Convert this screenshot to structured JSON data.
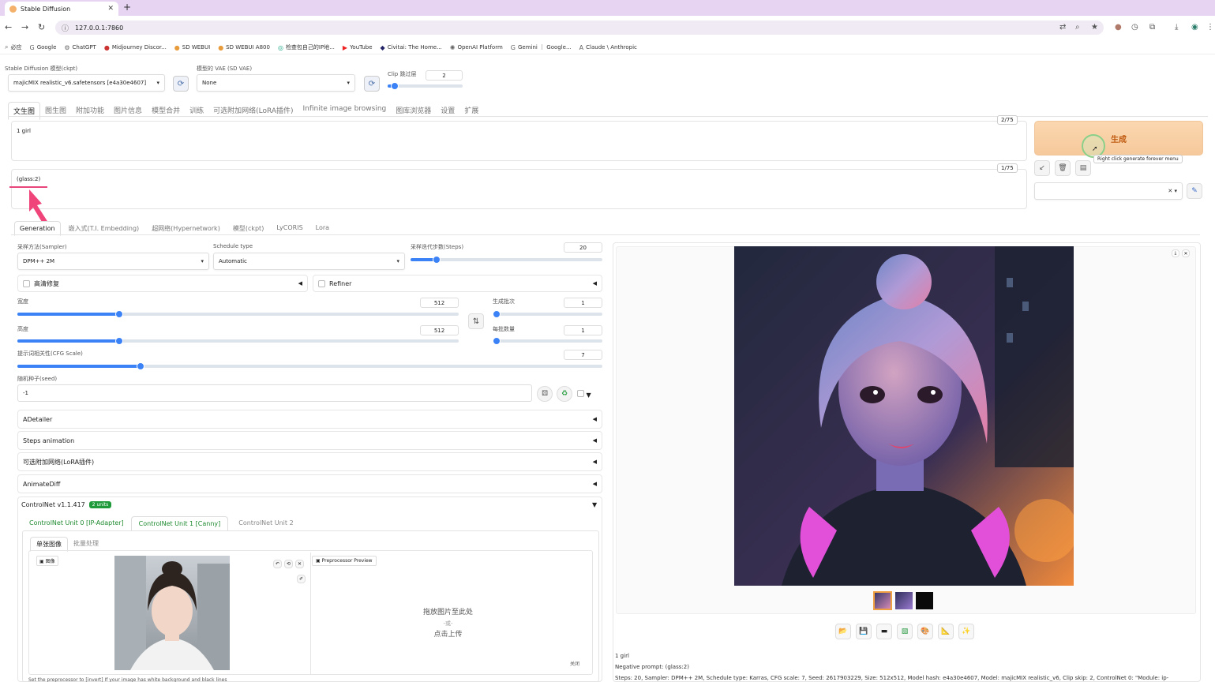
{
  "browser": {
    "tab_title": "Stable Diffusion",
    "url": "127.0.0.1:7860",
    "bookmarks": [
      "必应",
      "Google",
      "ChatGPT",
      "Midjourney Discor...",
      "SD WEBUI",
      "SD WEBUI A800",
      "检查包自己的IP地...",
      "YouTube",
      "Civitai: The Home...",
      "OpenAI Platform",
      "Gemini ｜ Google...",
      "Claude \\ Anthropic"
    ]
  },
  "top": {
    "model_label": "Stable Diffusion 模型(ckpt)",
    "model_value": "majicMIX realistic_v6.safetensors [e4a30e4607]",
    "vae_label": "模型的 VAE (SD VAE)",
    "vae_value": "None",
    "clip_label": "Clip 跳过层",
    "clip_value": "2",
    "clip_level": 0.1
  },
  "main_tabs": [
    "文生图",
    "图生图",
    "附加功能",
    "图片信息",
    "模型合并",
    "训练",
    "可选附加网络(LoRA插件)",
    "Infinite image browsing",
    "图库浏览器",
    "设置",
    "扩展"
  ],
  "prompt": {
    "positive": "1 girl",
    "positive_count": "2/75",
    "negative": "(glass:2)",
    "negative_count": "1/75"
  },
  "generate": {
    "label": "生成",
    "tooltip": "Right click generate forever menu"
  },
  "sub_tabs": [
    "Generation",
    "嵌入式(T.I. Embedding)",
    "超网络(Hypernetwork)",
    "模型(ckpt)",
    "LyCORIS",
    "Lora"
  ],
  "gen": {
    "sampler_label": "采样方法(Sampler)",
    "sampler_value": "DPM++ 2M",
    "schedule_label": "Schedule type",
    "schedule_value": "Automatic",
    "steps_label": "采样迭代步数(Steps)",
    "steps_value": "20",
    "hires_label": "高清修复",
    "refiner_label": "Refiner",
    "width_label": "宽度",
    "width_value": "512",
    "height_label": "高度",
    "height_value": "512",
    "batch_count_label": "生成批次",
    "batch_count_value": "1",
    "batch_size_label": "每批数量",
    "batch_size_value": "1",
    "cfg_label": "提示词相关性(CFG Scale)",
    "cfg_value": "7",
    "seed_label": "随机种子(seed)",
    "seed_value": "-1"
  },
  "accordions": [
    "ADetailer",
    "Steps animation",
    "可选附加网络(LoRA插件)",
    "AnimateDiff"
  ],
  "controlnet": {
    "title": "ControlNet v1.1.417",
    "badge": "2 units",
    "units": [
      "ControlNet Unit 0 [IP-Adapter]",
      "ControlNet Unit 1 [Canny]",
      "ControlNet Unit 2"
    ],
    "mode_tabs": [
      "单张图像",
      "批量处理"
    ],
    "image_label": "图像",
    "preview_label": "Preprocessor Preview",
    "drop_text": "拖放图片至此处",
    "or_text": "-或-",
    "upload_text": "点击上传",
    "close_text": "关闭",
    "bottom_hint": "Set the preprocessor to [invert] If your image has white background and black lines"
  },
  "output": {
    "info_prompt": "1 girl",
    "info_negative": "Negative prompt: (glass:2)",
    "info_params": "Steps: 20, Sampler: DPM++ 2M, Schedule type: Karras, CFG scale: 7, Seed: 2617903229, Size: 512x512, Model hash: e4a30e4607, Model: majicMIX realistic_v6, Clip skip: 2, ControlNet 0: \"Module: ip-"
  }
}
